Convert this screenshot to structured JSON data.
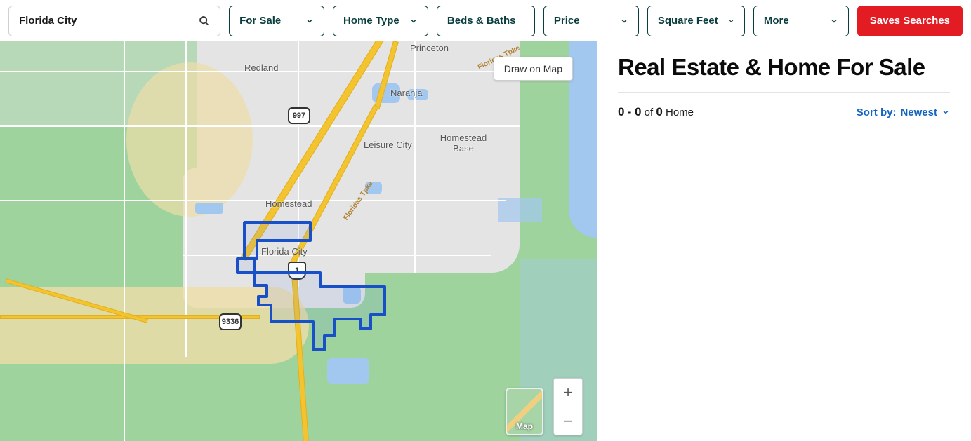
{
  "search": {
    "value": "Florida City"
  },
  "filters": {
    "for_sale": "For Sale",
    "home_type": "Home Type",
    "beds_baths": "Beds & Baths",
    "price": "Price",
    "square_feet": "Square Feet",
    "more": "More"
  },
  "saves_button": "Saves Searches",
  "map": {
    "draw_button": "Draw on Map",
    "toggle_label": "Map",
    "labels": {
      "redland": "Redland",
      "princeton": "Princeton",
      "naranja": "Naranja",
      "leisure_city": "Leisure City",
      "homestead_base": "Homestead Base",
      "homestead": "Homestead",
      "florida_city": "Florida City"
    },
    "shields": {
      "r997": "997",
      "r1": "1",
      "r9336": "9336"
    },
    "turnpike": "Floridas Tpke"
  },
  "results": {
    "title": "Real Estate & Home For Sale",
    "count_start": "0",
    "count_end": "0",
    "of_word": "of",
    "total": "0",
    "unit": "Home",
    "sort_label": "Sort by:",
    "sort_value": "Newest"
  }
}
